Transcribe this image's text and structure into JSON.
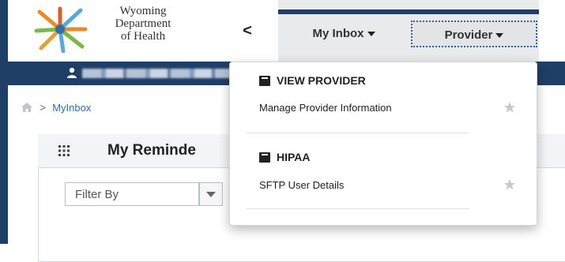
{
  "header": {
    "org_lines": [
      "Wyoming",
      "Department",
      "of Health"
    ],
    "collapse_symbol": "<",
    "nav": [
      {
        "label": "My Inbox"
      },
      {
        "label": "Provider"
      }
    ]
  },
  "breadcrumb": {
    "items": [
      "MyInbox"
    ]
  },
  "panel": {
    "title": "My Reminde"
  },
  "filter": {
    "value": "Filter By"
  },
  "dropdown": {
    "sections": [
      {
        "title": "VIEW PROVIDER",
        "items": [
          {
            "label": "Manage Provider Information",
            "favorite_icon": "star-icon"
          }
        ]
      },
      {
        "title": "HIPAA",
        "items": [
          {
            "label": "SFTP User Details",
            "favorite_icon": "star-icon"
          }
        ]
      }
    ]
  },
  "colors": {
    "brand_navy": "#1f3f66",
    "link_blue": "#2a6fb0",
    "focus_outline": "#2a5fa3"
  }
}
